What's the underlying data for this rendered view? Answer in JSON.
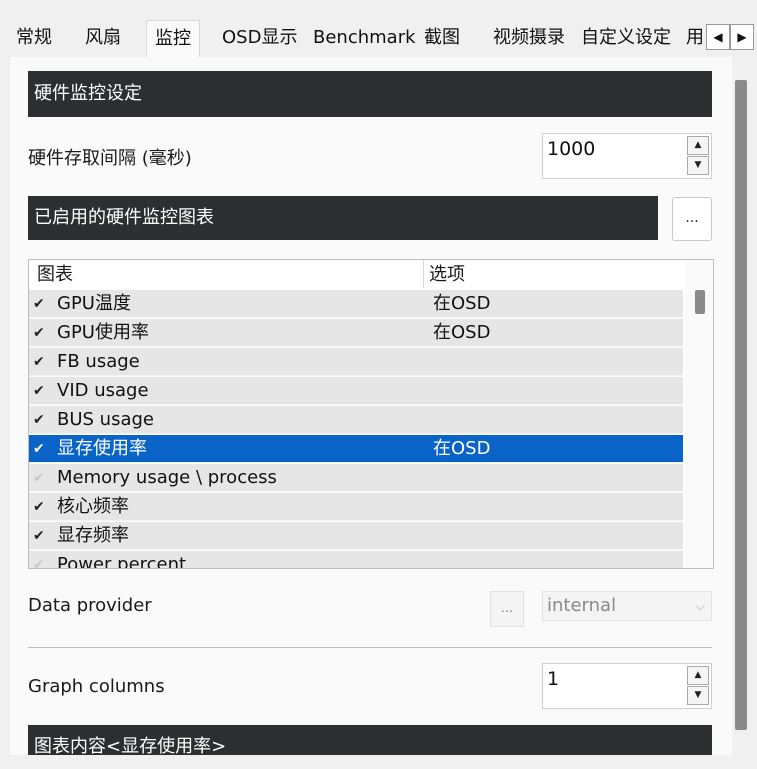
{
  "tabs": [
    "常规",
    "风扇",
    "监控",
    "OSD显示",
    "Benchmark",
    "截图",
    "视频摄录",
    "自定义设定",
    "用"
  ],
  "tab_scroll": {
    "left": "◀",
    "right": "▶"
  },
  "sections": {
    "hw_monitor_settings": "硬件监控设定",
    "enabled_graphs": "已启用的硬件监控图表",
    "graph_content": "图表内容<显存使用率>"
  },
  "polling": {
    "label": "硬件存取间隔 (毫秒)",
    "value": "1000"
  },
  "ellipsis": "...",
  "spin_arrows": {
    "up": "▲",
    "down": "▼"
  },
  "table": {
    "columns": [
      "图表",
      "选项"
    ],
    "rows": [
      {
        "check": "✔",
        "name": "GPU温度",
        "option": "在OSD"
      },
      {
        "check": "✔",
        "name": "GPU使用率",
        "option": "在OSD"
      },
      {
        "check": "✔",
        "name": "FB usage",
        "option": ""
      },
      {
        "check": "✔",
        "name": "VID usage",
        "option": ""
      },
      {
        "check": "✔",
        "name": "BUS usage",
        "option": ""
      },
      {
        "check": "✔",
        "name": "显存使用率",
        "option": "在OSD"
      },
      {
        "check": "✔",
        "name": "Memory usage \\ process",
        "option": ""
      },
      {
        "check": "✔",
        "name": "核心频率",
        "option": ""
      },
      {
        "check": "✔",
        "name": "显存频率",
        "option": ""
      },
      {
        "check": "✔",
        "name": "Power percent",
        "option": ""
      }
    ]
  },
  "data_provider": {
    "label": "Data provider",
    "value": "internal",
    "arrow": "⌵"
  },
  "graph_columns": {
    "label": "Graph columns",
    "value": "1"
  }
}
